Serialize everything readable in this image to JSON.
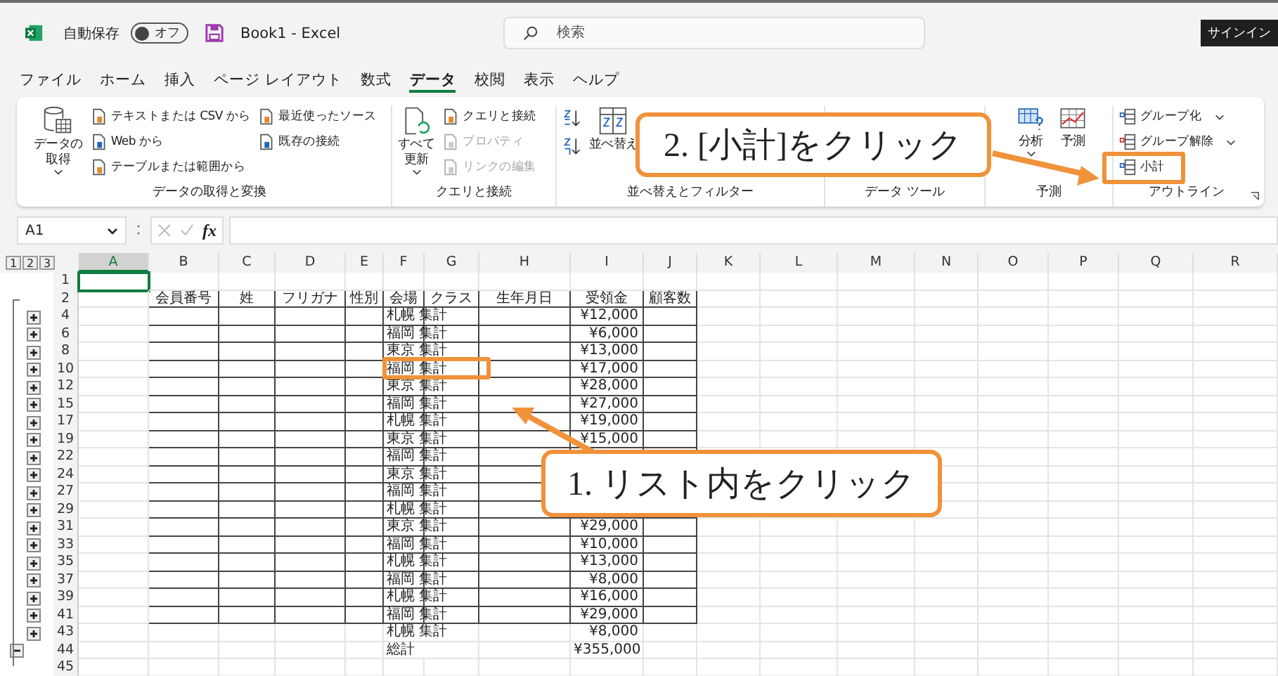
{
  "titlebar": {
    "autosave_label": "自動保存",
    "autosave": {
      "on": false,
      "label": "オフ"
    },
    "title": "Book1  -  Excel",
    "search": {
      "placeholder": "検索"
    },
    "signin": "サインイン"
  },
  "tabs": [
    {
      "label": "ファイル",
      "selected": false
    },
    {
      "label": "ホーム",
      "selected": false
    },
    {
      "label": "挿入",
      "selected": false
    },
    {
      "label": "ページ レイアウト",
      "selected": false
    },
    {
      "label": "数式",
      "selected": false
    },
    {
      "label": "データ",
      "selected": true
    },
    {
      "label": "校閲",
      "selected": false
    },
    {
      "label": "表示",
      "selected": false
    },
    {
      "label": "ヘルプ",
      "selected": false
    }
  ],
  "ribbon": [
    {
      "label": "データの取得と変換",
      "columns": [
        [
          {
            "kind": "large",
            "lines": [
              "データの",
              "取得"
            ],
            "dropdown": true,
            "disabled": false
          }
        ],
        [
          {
            "kind": "small",
            "text": "テキストまたは CSV から",
            "disabled": false
          },
          {
            "kind": "small",
            "text": "Web から",
            "disabled": false
          },
          {
            "kind": "small",
            "text": "テーブルまたは範囲から",
            "disabled": false
          }
        ],
        [
          {
            "kind": "small",
            "text": "最近使ったソース",
            "disabled": false
          },
          {
            "kind": "small",
            "text": "既存の接続",
            "disabled": false
          }
        ]
      ]
    },
    {
      "label": "クエリと接続",
      "columns": [
        [
          {
            "kind": "large",
            "lines": [
              "すべて",
              "更新"
            ],
            "dropdown": true,
            "disabled": false
          }
        ],
        [
          {
            "kind": "small",
            "text": "クエリと接続",
            "disabled": false
          },
          {
            "kind": "small",
            "text": "プロパティ",
            "disabled": true
          },
          {
            "kind": "small",
            "text": "リンクの編集",
            "disabled": true
          }
        ]
      ]
    },
    {
      "label": "並べ替えとフィルター",
      "columns": [
        [
          {
            "kind": "sort"
          }
        ],
        [
          {
            "kind": "large",
            "lines": [
              "並べ替え"
            ],
            "dropdown": false,
            "disabled": false
          }
        ]
      ]
    },
    {
      "label": "データ ツール"
    },
    {
      "label": "予測",
      "columns": [
        [
          {
            "kind": "large",
            "lines": [
              "分析"
            ],
            "dropdown": true,
            "disabled": false
          }
        ],
        [
          {
            "kind": "large",
            "lines": [
              "予測"
            ],
            "dropdown": false,
            "disabled": false
          }
        ]
      ]
    },
    {
      "label": "アウトライン",
      "columns": [
        [
          {
            "kind": "small",
            "text": "グループ化",
            "dropdown": true,
            "disabled": false
          },
          {
            "kind": "small",
            "text": "グループ解除",
            "dropdown": true,
            "disabled": false
          },
          {
            "kind": "small",
            "text": "小計",
            "disabled": false
          }
        ]
      ]
    }
  ],
  "formula_bar": {
    "name_box": "A1",
    "fx": "fx"
  },
  "outline_levels": [
    "1",
    "2",
    "3"
  ],
  "columns": [
    {
      "label": "A",
      "selected": true
    },
    {
      "label": "B",
      "selected": false
    },
    {
      "label": "C",
      "selected": false
    },
    {
      "label": "D",
      "selected": false
    },
    {
      "label": "E",
      "selected": false
    },
    {
      "label": "F",
      "selected": false
    },
    {
      "label": "G",
      "selected": false
    },
    {
      "label": "H",
      "selected": false
    },
    {
      "label": "I",
      "selected": false
    },
    {
      "label": "J",
      "selected": false
    },
    {
      "label": "K",
      "selected": false
    },
    {
      "label": "L",
      "selected": false
    },
    {
      "label": "M",
      "selected": false
    },
    {
      "label": "N",
      "selected": false
    },
    {
      "label": "O",
      "selected": false
    },
    {
      "label": "P",
      "selected": false
    },
    {
      "label": "Q",
      "selected": false
    },
    {
      "label": "R",
      "selected": false
    }
  ],
  "rows": [
    {
      "num": "1",
      "bordered": false,
      "a_selected": true
    },
    {
      "num": "2",
      "bordered": true,
      "cells": [
        "会員番号",
        "姓",
        "フリガナ",
        "性別",
        "会場",
        "クラス",
        "生年月日",
        "受領金",
        "顧客数"
      ]
    },
    {
      "num": "4",
      "bordered": true,
      "expanded": false,
      "venue": "札幌 集計",
      "amount": "¥12,000"
    },
    {
      "num": "6",
      "bordered": true,
      "expanded": false,
      "venue": "福岡 集計",
      "amount": "¥6,000"
    },
    {
      "num": "8",
      "bordered": true,
      "expanded": false,
      "venue": "東京 集計",
      "amount": "¥13,000"
    },
    {
      "num": "10",
      "bordered": true,
      "expanded": false,
      "venue": "福岡 集計",
      "amount": "¥17,000"
    },
    {
      "num": "12",
      "bordered": true,
      "expanded": false,
      "venue": "東京 集計",
      "amount": "¥28,000"
    },
    {
      "num": "15",
      "bordered": true,
      "expanded": false,
      "venue": "福岡 集計",
      "amount": "¥27,000"
    },
    {
      "num": "17",
      "bordered": true,
      "expanded": false,
      "venue": "札幌 集計",
      "amount": "¥19,000"
    },
    {
      "num": "19",
      "bordered": true,
      "expanded": false,
      "venue": "東京 集計",
      "amount": "¥15,000"
    },
    {
      "num": "22",
      "bordered": true,
      "expanded": false,
      "venue": "福岡 集計"
    },
    {
      "num": "24",
      "bordered": true,
      "expanded": false,
      "venue": "東京 集計"
    },
    {
      "num": "27",
      "bordered": true,
      "expanded": false,
      "venue": "福岡 集計"
    },
    {
      "num": "29",
      "bordered": true,
      "expanded": false,
      "venue": "札幌 集計"
    },
    {
      "num": "31",
      "bordered": true,
      "expanded": false,
      "venue": "東京 集計",
      "amount": "¥29,000"
    },
    {
      "num": "33",
      "bordered": true,
      "expanded": false,
      "venue": "福岡 集計",
      "amount": "¥10,000"
    },
    {
      "num": "35",
      "bordered": true,
      "expanded": false,
      "venue": "札幌 集計",
      "amount": "¥13,000"
    },
    {
      "num": "37",
      "bordered": true,
      "expanded": false,
      "venue": "福岡 集計",
      "amount": "¥8,000"
    },
    {
      "num": "39",
      "bordered": true,
      "expanded": false,
      "venue": "札幌 集計",
      "amount": "¥16,000"
    },
    {
      "num": "41",
      "bordered": true,
      "expanded": false,
      "venue": "福岡 集計",
      "amount": "¥29,000"
    },
    {
      "num": "43",
      "bordered": false,
      "expanded": false,
      "venue": "札幌 集計",
      "amount": "¥8,000"
    },
    {
      "num": "44",
      "bordered": false,
      "expanded": true,
      "venue": "総計",
      "amount": "¥355,000"
    },
    {
      "num": "45",
      "bordered": false
    }
  ],
  "callouts": [
    {
      "text": "2. [小計]をクリック"
    },
    {
      "text": "1. リスト内をクリック"
    }
  ]
}
